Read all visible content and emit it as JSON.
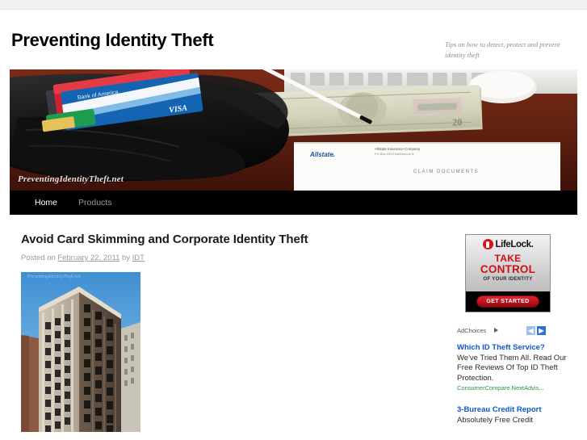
{
  "site": {
    "title": "Preventing Identity Theft",
    "description": "Tips on how to detect, protect and prevent identity theft",
    "banner_watermark": "PreventingIdentityTheft.net"
  },
  "nav": {
    "items": [
      {
        "label": "Home",
        "active": true
      },
      {
        "label": "Products",
        "active": false
      }
    ]
  },
  "post": {
    "title": "Avoid Card Skimming and Corporate Identity Theft",
    "meta_prefix": "Posted on ",
    "date": "February 22, 2011",
    "meta_by": " by ",
    "author": "IDT",
    "image_watermark": "PreventingIdentityTheft.net"
  },
  "sidebar": {
    "lifelock": {
      "brand": "LifeLock.",
      "line1": "TAKE",
      "line2": "CONTROL",
      "line3": "OF YOUR IDENTITY",
      "cta": "GET STARTED"
    },
    "adchoices": {
      "label": "AdChoices",
      "prev": "◀",
      "next": "▶"
    },
    "text_ads": [
      {
        "headline": "Which ID Theft Service?",
        "body": "We've Tried Them All. Read Our Free Reviews Of Top ID Theft Protection.",
        "url": "ConsumerCompare.NextAdvis..."
      },
      {
        "headline": "3-Bureau Credit Report",
        "body": "Absolutely Free Credit",
        "url": ""
      }
    ]
  },
  "colors": {
    "nav_background": "#000000",
    "link_blue": "#1155cc",
    "ad_url_green": "#2a9541",
    "lifelock_red": "#cc1118"
  }
}
